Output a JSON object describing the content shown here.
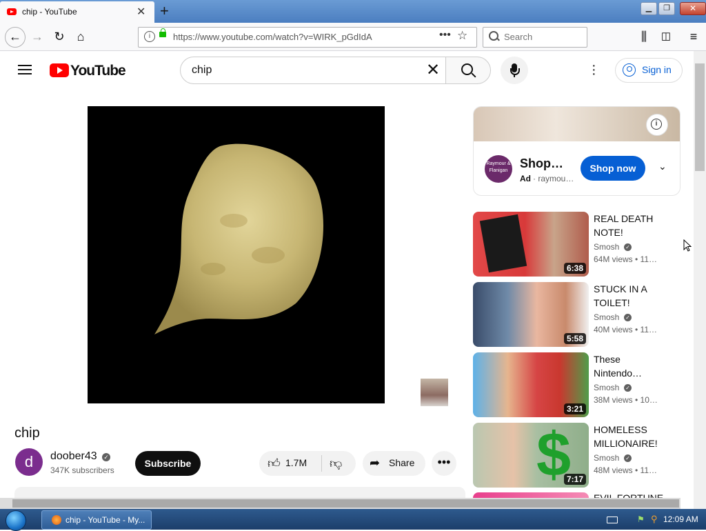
{
  "browser": {
    "tab_title": "chip - YouTube",
    "url": "https://www.youtube.com/watch?v=WIRK_pGdIdA",
    "search_placeholder": "Search"
  },
  "youtube": {
    "logo_text": "YouTube",
    "search_query": "chip",
    "sign_in_label": "Sign in"
  },
  "video": {
    "title": "chip",
    "channel_initial": "d",
    "channel_name": "doober43",
    "subscribers": "347K subscribers",
    "subscribe_label": "Subscribe",
    "likes": "1.7M",
    "share_label": "Share"
  },
  "ad": {
    "title": "Shop…",
    "badge": "Ad",
    "source": "· raymou…",
    "cta": "Shop now",
    "logo_text": "Raymour & Flanigan"
  },
  "recommendations": [
    {
      "title": "REAL DEATH NOTE!",
      "channel": "Smosh",
      "meta": "64M views • 11…",
      "duration": "6:38"
    },
    {
      "title": "STUCK IN A TOILET!",
      "channel": "Smosh",
      "meta": "40M views • 11…",
      "duration": "5:58"
    },
    {
      "title": "These Nintendo…",
      "channel": "Smosh",
      "meta": "38M views • 10…",
      "duration": "3:21"
    },
    {
      "title": "HOMELESS MILLIONAIRE!",
      "channel": "Smosh",
      "meta": "48M views • 11…",
      "duration": "7:17"
    },
    {
      "title": "EVIL FORTUNE"
    }
  ],
  "taskbar": {
    "item_label": "chip - YouTube - My...",
    "clock": "12:09 AM"
  },
  "icons": {
    "back": "back-arrow-icon",
    "forward": "forward-arrow-icon",
    "reload": "reload-icon",
    "home": "home-icon",
    "library": "library-icon",
    "sidebar": "sidebar-icon",
    "menu": "hamburger-menu-icon"
  },
  "colors": {
    "youtube_red": "#ff0000",
    "link_blue": "#065fd4",
    "taskbar": "#1c3e6a"
  }
}
